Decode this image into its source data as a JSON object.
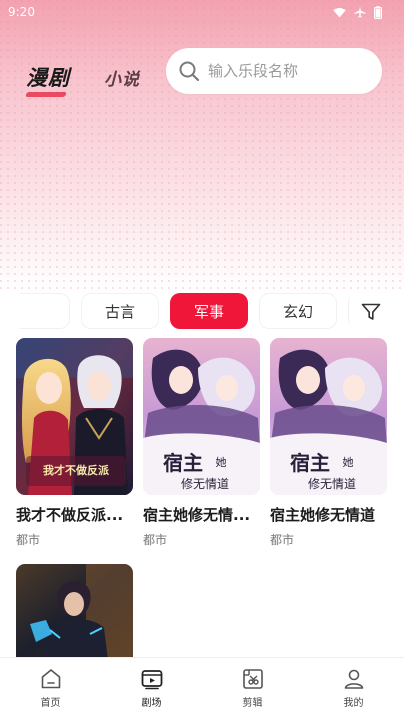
{
  "status_bar": {
    "time": "9:20"
  },
  "header": {
    "tabs": [
      {
        "label": "漫剧",
        "active": true
      },
      {
        "label": "小说",
        "active": false
      }
    ],
    "search": {
      "placeholder": "输入乐段名称",
      "value": ""
    }
  },
  "genres": {
    "items": [
      {
        "label": "·",
        "active": false
      },
      {
        "label": "古言",
        "active": false
      },
      {
        "label": "军事",
        "active": true
      },
      {
        "label": "玄幻",
        "active": false
      },
      {
        "label": "·",
        "active": false
      }
    ],
    "filter_icon": "filter-icon"
  },
  "dramas": [
    {
      "title": "我才不做反派...",
      "tag": "都市",
      "cover_text": "我才不做反派"
    },
    {
      "title": "宿主她修无情...",
      "tag": "都市",
      "cover_text": "宿主她修无情道"
    },
    {
      "title": "宿主她修无情道",
      "tag": "都市",
      "cover_text": "宿主她修无情道"
    },
    {
      "title": "",
      "tag": "",
      "cover_text": ""
    }
  ],
  "bottom_nav": [
    {
      "label": "首页",
      "icon": "home-icon",
      "active": false
    },
    {
      "label": "剧场",
      "icon": "theater-icon",
      "active": true
    },
    {
      "label": "剪辑",
      "icon": "clip-icon",
      "active": false
    },
    {
      "label": "我的",
      "icon": "profile-icon",
      "active": false
    }
  ],
  "colors": {
    "accent": "#f0163a",
    "hero_top": "#f3a1b0"
  }
}
